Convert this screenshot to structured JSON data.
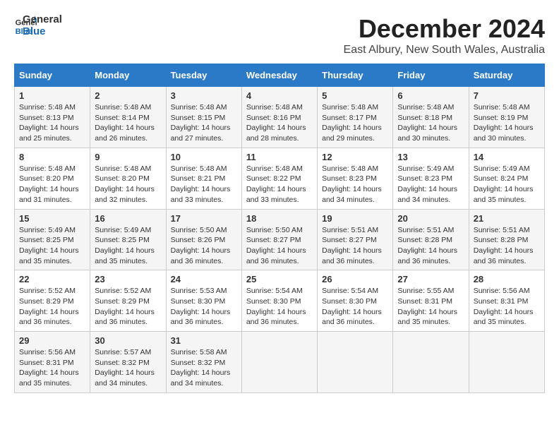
{
  "logo": {
    "line1": "General",
    "line2": "Blue"
  },
  "title": "December 2024",
  "subtitle": "East Albury, New South Wales, Australia",
  "days_of_week": [
    "Sunday",
    "Monday",
    "Tuesday",
    "Wednesday",
    "Thursday",
    "Friday",
    "Saturday"
  ],
  "weeks": [
    [
      {
        "day": "1",
        "rise": "5:48 AM",
        "set": "8:13 PM",
        "daylight": "14 hours and 25 minutes."
      },
      {
        "day": "2",
        "rise": "5:48 AM",
        "set": "8:14 PM",
        "daylight": "14 hours and 26 minutes."
      },
      {
        "day": "3",
        "rise": "5:48 AM",
        "set": "8:15 PM",
        "daylight": "14 hours and 27 minutes."
      },
      {
        "day": "4",
        "rise": "5:48 AM",
        "set": "8:16 PM",
        "daylight": "14 hours and 28 minutes."
      },
      {
        "day": "5",
        "rise": "5:48 AM",
        "set": "8:17 PM",
        "daylight": "14 hours and 29 minutes."
      },
      {
        "day": "6",
        "rise": "5:48 AM",
        "set": "8:18 PM",
        "daylight": "14 hours and 30 minutes."
      },
      {
        "day": "7",
        "rise": "5:48 AM",
        "set": "8:19 PM",
        "daylight": "14 hours and 30 minutes."
      }
    ],
    [
      {
        "day": "8",
        "rise": "5:48 AM",
        "set": "8:20 PM",
        "daylight": "14 hours and 31 minutes."
      },
      {
        "day": "9",
        "rise": "5:48 AM",
        "set": "8:20 PM",
        "daylight": "14 hours and 32 minutes."
      },
      {
        "day": "10",
        "rise": "5:48 AM",
        "set": "8:21 PM",
        "daylight": "14 hours and 33 minutes."
      },
      {
        "day": "11",
        "rise": "5:48 AM",
        "set": "8:22 PM",
        "daylight": "14 hours and 33 minutes."
      },
      {
        "day": "12",
        "rise": "5:48 AM",
        "set": "8:23 PM",
        "daylight": "14 hours and 34 minutes."
      },
      {
        "day": "13",
        "rise": "5:49 AM",
        "set": "8:23 PM",
        "daylight": "14 hours and 34 minutes."
      },
      {
        "day": "14",
        "rise": "5:49 AM",
        "set": "8:24 PM",
        "daylight": "14 hours and 35 minutes."
      }
    ],
    [
      {
        "day": "15",
        "rise": "5:49 AM",
        "set": "8:25 PM",
        "daylight": "14 hours and 35 minutes."
      },
      {
        "day": "16",
        "rise": "5:49 AM",
        "set": "8:25 PM",
        "daylight": "14 hours and 35 minutes."
      },
      {
        "day": "17",
        "rise": "5:50 AM",
        "set": "8:26 PM",
        "daylight": "14 hours and 36 minutes."
      },
      {
        "day": "18",
        "rise": "5:50 AM",
        "set": "8:27 PM",
        "daylight": "14 hours and 36 minutes."
      },
      {
        "day": "19",
        "rise": "5:51 AM",
        "set": "8:27 PM",
        "daylight": "14 hours and 36 minutes."
      },
      {
        "day": "20",
        "rise": "5:51 AM",
        "set": "8:28 PM",
        "daylight": "14 hours and 36 minutes."
      },
      {
        "day": "21",
        "rise": "5:51 AM",
        "set": "8:28 PM",
        "daylight": "14 hours and 36 minutes."
      }
    ],
    [
      {
        "day": "22",
        "rise": "5:52 AM",
        "set": "8:29 PM",
        "daylight": "14 hours and 36 minutes."
      },
      {
        "day": "23",
        "rise": "5:52 AM",
        "set": "8:29 PM",
        "daylight": "14 hours and 36 minutes."
      },
      {
        "day": "24",
        "rise": "5:53 AM",
        "set": "8:30 PM",
        "daylight": "14 hours and 36 minutes."
      },
      {
        "day": "25",
        "rise": "5:54 AM",
        "set": "8:30 PM",
        "daylight": "14 hours and 36 minutes."
      },
      {
        "day": "26",
        "rise": "5:54 AM",
        "set": "8:30 PM",
        "daylight": "14 hours and 36 minutes."
      },
      {
        "day": "27",
        "rise": "5:55 AM",
        "set": "8:31 PM",
        "daylight": "14 hours and 35 minutes."
      },
      {
        "day": "28",
        "rise": "5:56 AM",
        "set": "8:31 PM",
        "daylight": "14 hours and 35 minutes."
      }
    ],
    [
      {
        "day": "29",
        "rise": "5:56 AM",
        "set": "8:31 PM",
        "daylight": "14 hours and 35 minutes."
      },
      {
        "day": "30",
        "rise": "5:57 AM",
        "set": "8:32 PM",
        "daylight": "14 hours and 34 minutes."
      },
      {
        "day": "31",
        "rise": "5:58 AM",
        "set": "8:32 PM",
        "daylight": "14 hours and 34 minutes."
      },
      null,
      null,
      null,
      null
    ]
  ]
}
